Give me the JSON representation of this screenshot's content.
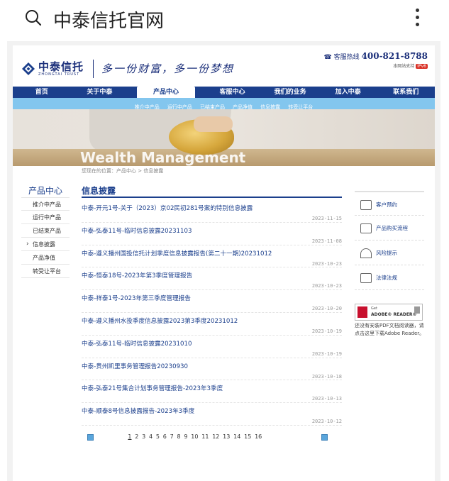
{
  "topbar": {
    "title": "中泰信托官网"
  },
  "header": {
    "logo_cn": "中泰信托",
    "logo_en": "ZHONGTAI TRUST",
    "slogan": "多一份财富，多一份梦想",
    "hotline_label": "客服热线",
    "hotline_number": "400-821-8788",
    "ipv6_note": "本网站支持",
    "ipv6_badge": "IPv6"
  },
  "nav": [
    "首页",
    "关于中泰",
    "产品中心",
    "客服中心",
    "我们的业务",
    "加入中泰",
    "联系我们"
  ],
  "subnav": [
    "推介中产品",
    "运行中产品",
    "已结束产品",
    "产品净值",
    "信息披露",
    "转受让平台"
  ],
  "banner": {
    "text": "Wealth Management"
  },
  "breadcrumb": "您现在的位置：产品中心 > 信息披露",
  "sidebar": {
    "title": "产品中心",
    "items": [
      "推介中产品",
      "运行中产品",
      "已结束产品",
      "信息披露",
      "产品净值",
      "转受让平台"
    ]
  },
  "main": {
    "title": "信息披露",
    "items": [
      {
        "title": "中泰-开元1号-关于（2023）京02民初281号案的特别信息披露",
        "date": "2023-11-15"
      },
      {
        "title": "中泰-弘泰11号-临时信息披露20231103",
        "date": "2023-11-08"
      },
      {
        "title": "中泰-遵义播州国投信托计划季度信息披露报告(第二十一期)20231012",
        "date": "2023-10-23"
      },
      {
        "title": "中泰-恒泰18号-2023年第3季度管理报告",
        "date": "2023-10-23"
      },
      {
        "title": "中泰-祥泰1号-2023年第三季度管理报告",
        "date": "2023-10-20"
      },
      {
        "title": "中泰-遵义播州水投季度信息披露2023第3季度20231012",
        "date": "2023-10-19"
      },
      {
        "title": "中泰-弘泰11号-临时信息披露20231010",
        "date": "2023-10-19"
      },
      {
        "title": "中泰-贵州凯里事务管理报告20230930",
        "date": "2023-10-18"
      },
      {
        "title": "中泰-弘泰21号集合计划事务管理报告-2023年3季度",
        "date": "2023-10-13"
      },
      {
        "title": "中泰-顺泰8号信息披露报告-2023年3季度",
        "date": "2023-10-12"
      }
    ]
  },
  "pager": {
    "pages": [
      "1",
      "2",
      "3",
      "4",
      "5",
      "6",
      "7",
      "8",
      "9",
      "10",
      "11",
      "12",
      "13",
      "14",
      "15",
      "16"
    ]
  },
  "right_links": [
    "客户预约",
    "产品购买流程",
    "风险提示",
    "法律法规"
  ],
  "adobe": {
    "get": "Get",
    "name": "ADOBE® READER®",
    "note": "还没有安装PDF文档阅读器，请点击这里下载Adobe Reader。"
  }
}
